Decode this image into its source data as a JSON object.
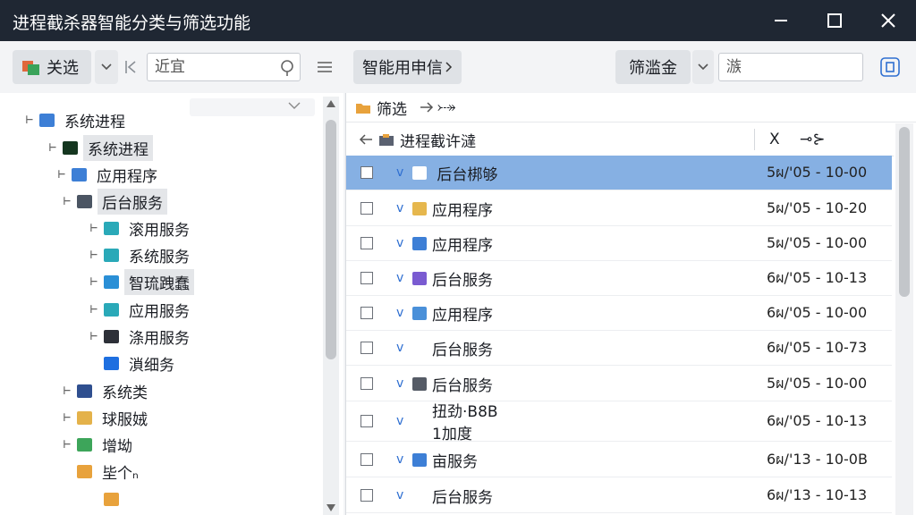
{
  "window": {
    "title": "进程截杀器智能分类与筛选功能"
  },
  "toolbar": {
    "select_button": "关选",
    "search_placeholder": "近宜",
    "smart_button": "智能用申信",
    "filter_button": "筛滥金",
    "filter_input_placeholder": "㵀"
  },
  "tree": {
    "items": [
      {
        "label": "系统进程",
        "icon_color": "#3d7fd6"
      },
      {
        "label": "系统进程",
        "icon_color": "#14361f"
      },
      {
        "label": "应用程序",
        "icon_color": "#3d7fd6"
      },
      {
        "label": "后台服务",
        "icon_color": "#4b5563"
      },
      {
        "label": "滚用服务",
        "icon_color": "#2aa9b8"
      },
      {
        "label": "系统服务",
        "icon_color": "#2aa9b8"
      },
      {
        "label": "智琉跩蠢",
        "icon_color": "#2a8fd6"
      },
      {
        "label": "应用服务",
        "icon_color": "#2aa9b8"
      },
      {
        "label": "涤用服务",
        "icon_color": "#2d3038"
      },
      {
        "label": "溑细务",
        "icon_color": "#1e6fe0"
      },
      {
        "label": "系统类",
        "icon_color": "#2f4f8f"
      },
      {
        "label": "球服娀",
        "icon_color": "#e4b24a"
      },
      {
        "label": "增坳",
        "icon_color": "#3da55a"
      },
      {
        "label": "坒个ₙ",
        "icon_color": "#e8a23c"
      },
      {
        "label": "",
        "icon_color": "#e8a23c"
      }
    ]
  },
  "right": {
    "breadcrumb": {
      "folder": "筛选",
      "tail": "⤐"
    },
    "header": {
      "title": "进程截许澾",
      "col_x": "X",
      "col_time": "⊸⊱"
    },
    "rows": [
      {
        "name": "⁠ 后台梆够",
        "time": "5ผ/'05 - 10-00",
        "icon_color": "#ffffff"
      },
      {
        "name": "应用程序",
        "time": "5ผ/'05 - 10-20",
        "icon_color": "#e6b74d"
      },
      {
        "name": "应用程序",
        "time": "5ผ/'05 - 10-00",
        "icon_color": "#3d7fd6"
      },
      {
        "name": "后台服务",
        "time": "6ผ/'05 - 10-13",
        "icon_color": "#7a5bd1"
      },
      {
        "name": "应用程序",
        "time": "6ผ/'05 - 10-00",
        "icon_color": "#4a90d9"
      },
      {
        "name": "后台服务",
        "time": "6ผ/'05 - 10-73",
        "icon_color": "#ffffff"
      },
      {
        "name": "后台服务",
        "time": "5ผ/'05 - 10-00",
        "icon_color": "#555b66"
      },
      {
        "name": "扭劲·B8B",
        "name2": "1加度",
        "time": "6ผ/'05 - 10-13",
        "icon_color": "#ffffff"
      },
      {
        "name": "亩服务",
        "time": "6ผ/'13 - 10-0B",
        "icon_color": "#3d7fd6"
      },
      {
        "name": "后台服务",
        "time": "6ผ/'13 - 10-13",
        "icon_color": "#ffffff"
      }
    ]
  }
}
